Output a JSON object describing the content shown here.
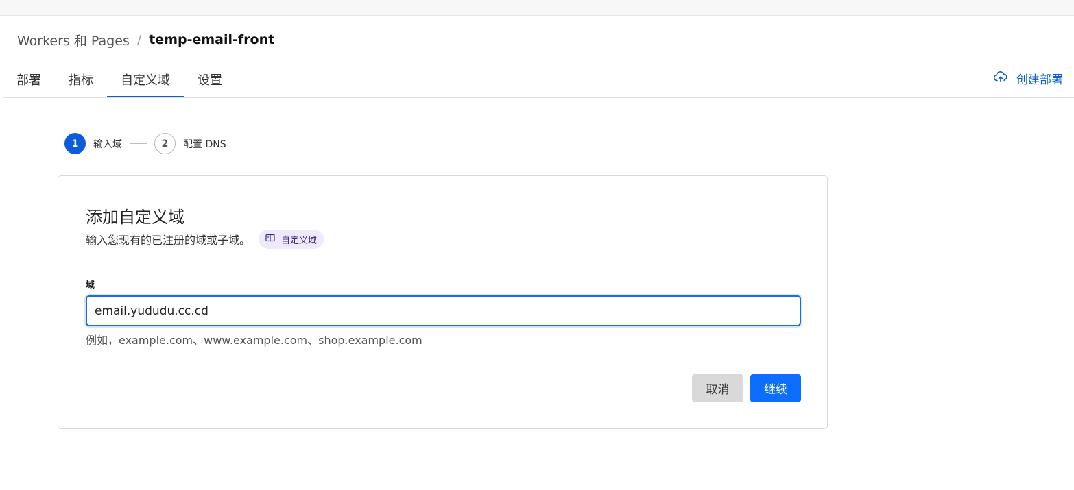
{
  "breadcrumb": {
    "root": "Workers 和 Pages",
    "separator": "/",
    "current": "temp-email-front"
  },
  "tabs": [
    {
      "label": "部署",
      "active": false
    },
    {
      "label": "指标",
      "active": false
    },
    {
      "label": "自定义域",
      "active": true
    },
    {
      "label": "设置",
      "active": false
    }
  ],
  "header_action": {
    "label": "创建部署",
    "icon": "cloud-upload-icon"
  },
  "stepper": {
    "steps": [
      {
        "number": "1",
        "label": "输入域",
        "active": true
      },
      {
        "number": "2",
        "label": "配置 DNS",
        "active": false
      }
    ]
  },
  "form": {
    "title": "添加自定义域",
    "subtitle": "输入您现有的已注册的域或子域。",
    "doc_chip": {
      "label": "自定义域",
      "icon": "book-icon"
    },
    "field_label": "域",
    "field_value": "email.yududu.cc.cd",
    "hint": "例如，example.com、www.example.com、shop.example.com",
    "cancel_label": "取消",
    "continue_label": "继续"
  },
  "colors": {
    "accent": "#0b5ed7",
    "primary_button": "#0d6efd",
    "cancel_button": "#d9d9d9",
    "chip_bg": "#efeafb"
  }
}
